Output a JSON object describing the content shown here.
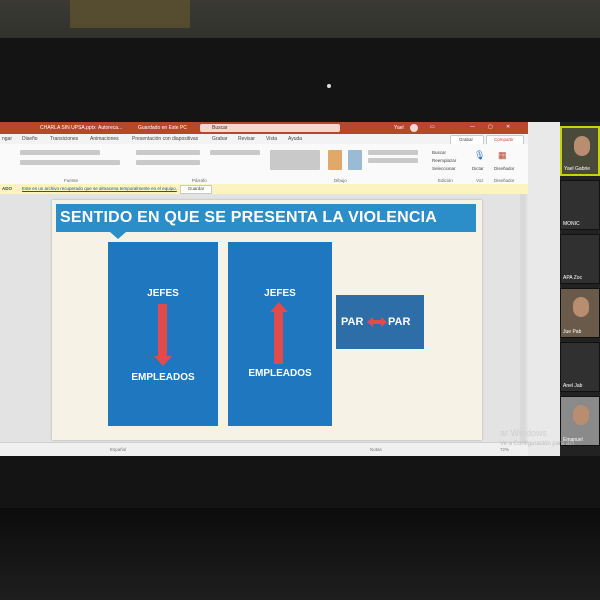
{
  "window": {
    "file_title": "CHARLA SIN UPSA.pptx",
    "autosave_label": "Autoreca...",
    "saved_label": "Guardado en Este PC",
    "search_placeholder": "Buscar",
    "user_label": "Yael"
  },
  "menu": {
    "items": [
      "ngar",
      "Diseño",
      "Transiciones",
      "Animaciones",
      "Presentación con diapositivas",
      "Grabar",
      "Revisar",
      "Vista",
      "Ayuda"
    ],
    "grabar_btn": "Grabar",
    "share_btn": "Compartir"
  },
  "ribbon": {
    "groups": [
      "Fuente",
      "Párrafo",
      "Dibujo",
      "Edición",
      "Voz",
      "Diseñador"
    ],
    "organize": "Organizar",
    "styles": "Estilos rápidos",
    "find": "Buscar",
    "replace": "Reemplazar",
    "select": "Seleccionar",
    "dictate": "Dictar",
    "designer": "Diseñador"
  },
  "notification": {
    "label": "ADO",
    "text": "Este es un archivo recuperado que se almacena temporalmente en el equipo.",
    "keep_button": "Guardar"
  },
  "slide": {
    "title": "SENTIDO EN QUE SE PRESENTA LA VIOLENCIA",
    "panel1": {
      "top": "JEFES",
      "bottom": "EMPLEADOS"
    },
    "panel2": {
      "top": "JEFES",
      "bottom": "EMPLEADOS"
    },
    "par_left": "PAR",
    "par_right": "PAR"
  },
  "statusbar": {
    "slide_info": "Español",
    "notes": "Notas",
    "zoom": "72%"
  },
  "participants": [
    {
      "name": "Yael Gabrie",
      "active": true
    },
    {
      "name": "MONIC",
      "active": false
    },
    {
      "name": "APA Zoc",
      "active": false
    },
    {
      "name": "Jue Pab",
      "active": false
    },
    {
      "name": "Anel Jab",
      "active": false
    },
    {
      "name": "Emanuel",
      "active": false
    }
  ],
  "watermark": {
    "line1": "ar Windows",
    "line2": "Ve a Configuración para act"
  },
  "colors": {
    "ppt_accent": "#b7472a",
    "title_blue": "#2c8ec9",
    "panel_blue": "#1e77bf",
    "arrow_red": "#e24b4b"
  }
}
